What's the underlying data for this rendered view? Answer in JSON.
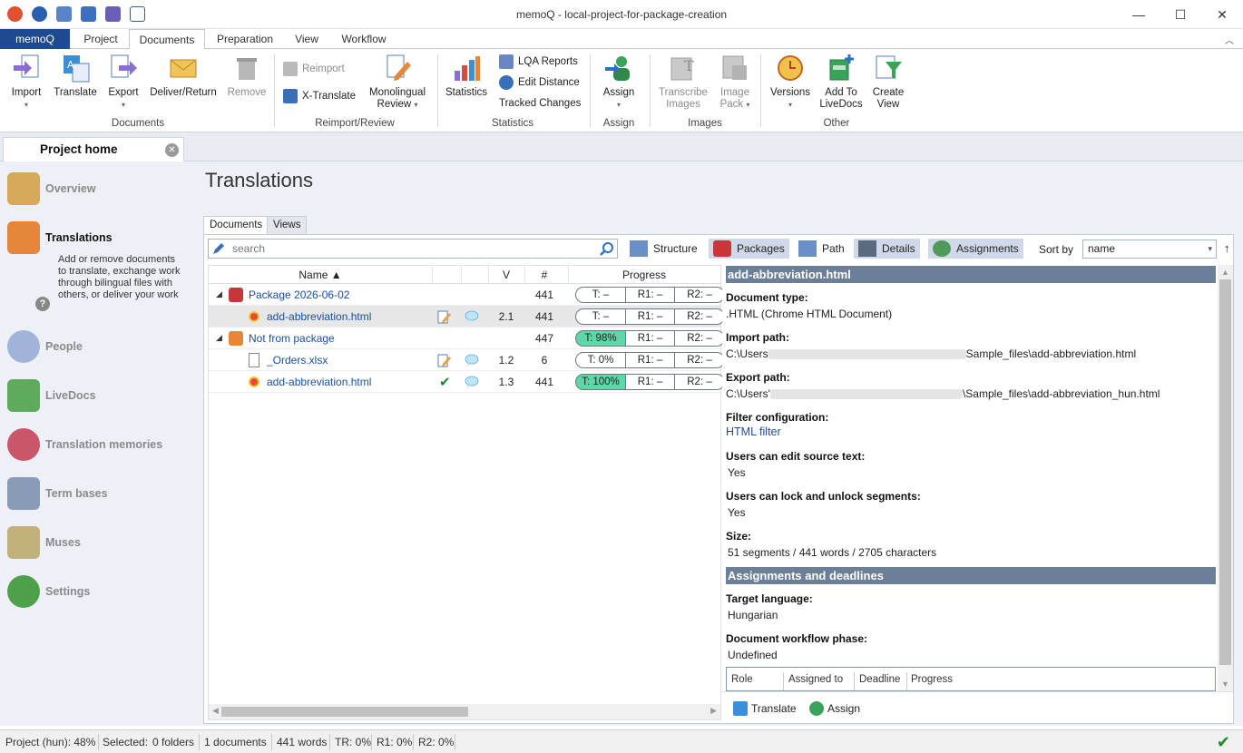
{
  "window": {
    "title": "memoQ - local-project-for-package-creation",
    "minimize": "—",
    "maximize": "☐",
    "close": "✕"
  },
  "ribbon_tabs": {
    "app": "memoQ",
    "project": "Project",
    "documents": "Documents",
    "preparation": "Preparation",
    "view": "View",
    "workflow": "Workflow",
    "collapse": "︿"
  },
  "ribbon": {
    "import": "Import",
    "translate": "Translate",
    "export": "Export",
    "deliver_return": "Deliver/Return",
    "remove": "Remove",
    "group_documents": "Documents",
    "reimport": "Reimport",
    "x_translate": "X-Translate",
    "monolingual_review_1": "Monolingual",
    "monolingual_review_2": "Review",
    "group_reimport_review": "Reimport/Review",
    "statistics": "Statistics",
    "lqa_reports": "LQA Reports",
    "edit_distance": "Edit Distance",
    "tracked_changes": "Tracked Changes",
    "group_statistics": "Statistics",
    "assign": "Assign",
    "group_assign": "Assign",
    "transcribe_images_1": "Transcribe",
    "transcribe_images_2": "Images",
    "image_pack_1": "Image",
    "image_pack_2": "Pack",
    "group_images": "Images",
    "versions": "Versions",
    "add_to_livedocs_1": "Add To",
    "add_to_livedocs_2": "LiveDocs",
    "create_view_1": "Create",
    "create_view_2": "View",
    "group_other": "Other",
    "dropdown_glyph": "▾"
  },
  "doc_tab": {
    "label": "Project home",
    "close": "✕"
  },
  "nav": {
    "overview": "Overview",
    "translations": "Translations",
    "translations_desc": "Add or remove documents to translate, exchange work through bilingual files with others, or deliver your work",
    "help": "?",
    "people": "People",
    "livedocs": "LiveDocs",
    "translation_memories": "Translation memories",
    "term_bases": "Term bases",
    "muses": "Muses",
    "settings": "Settings"
  },
  "main": {
    "title": "Translations",
    "tab_documents": "Documents",
    "tab_views": "Views",
    "search_placeholder": "search",
    "structure": "Structure",
    "packages": "Packages",
    "path": "Path",
    "details": "Details",
    "assignments": "Assignments",
    "sort_by": "Sort by",
    "sort_value": "name",
    "sort_dir": "↑",
    "caret": "▾"
  },
  "grid": {
    "col_name": "Name ▲",
    "col_v": "V",
    "col_hash": "#",
    "col_progress": "Progress",
    "rows": [
      {
        "name": "Package 2026-06-02",
        "v": "",
        "count": "441",
        "t": "T: –",
        "r1": "R1: –",
        "r2": "R2: –"
      },
      {
        "name": "add-abbreviation.html",
        "v": "2.1",
        "count": "441",
        "t": "T: –",
        "r1": "R1: –",
        "r2": "R2: –"
      },
      {
        "name": "Not from package",
        "v": "",
        "count": "447",
        "t": "T: 98%",
        "r1": "R1: –",
        "r2": "R2: –"
      },
      {
        "name": "_Orders.xlsx",
        "v": "1.2",
        "count": "6",
        "t": "T: 0%",
        "r1": "R1: –",
        "r2": "R2: –"
      },
      {
        "name": "add-abbreviation.html",
        "v": "1.3",
        "count": "441",
        "t": "T: 100%",
        "r1": "R1: –",
        "r2": "R2: –"
      }
    ],
    "checkmark": "✔"
  },
  "details": {
    "header": "add-abbreviation.html",
    "doc_type_label": "Document type:",
    "doc_type_value": ".HTML (Chrome HTML Document)",
    "import_label": "Import path:",
    "import_prefix": "C:\\Users",
    "import_suffix": "Sample_files\\add-abbreviation.html",
    "export_label": "Export path:",
    "export_prefix": "C:\\Users'",
    "export_suffix": "\\Sample_files\\add-abbreviation_hun.html",
    "filter_label": "Filter configuration:",
    "filter_value": "HTML filter",
    "edit_source_label": "Users can edit source text:",
    "edit_source_value": "Yes",
    "lock_label": "Users can lock and unlock segments:",
    "lock_value": "Yes",
    "size_label": "Size:",
    "size_value": "51 segments / 441 words / 2705 characters",
    "assignments_header": "Assignments and deadlines",
    "target_lang_label": "Target language:",
    "target_lang_value": "Hungarian",
    "phase_label": "Document workflow phase:",
    "phase_value": "Undefined",
    "mt_role": "Role",
    "mt_assigned": "Assigned to",
    "mt_deadline": "Deadline",
    "mt_progress": "Progress",
    "footer_translate": "Translate",
    "footer_assign": "Assign"
  },
  "statusbar": {
    "project": "Project (hun): 48%",
    "selected": "Selected:",
    "folders": "0 folders",
    "documents": "1 documents",
    "words": "441 words",
    "tr": "TR: 0%",
    "r1": "R1: 0%",
    "r2": "R2: 0%",
    "ok": "✔"
  },
  "colors": {
    "accent": "#1e4b8f",
    "progress_green": "#5dd6a8",
    "section_header": "#6c7f99",
    "link": "#1a4fa0"
  }
}
